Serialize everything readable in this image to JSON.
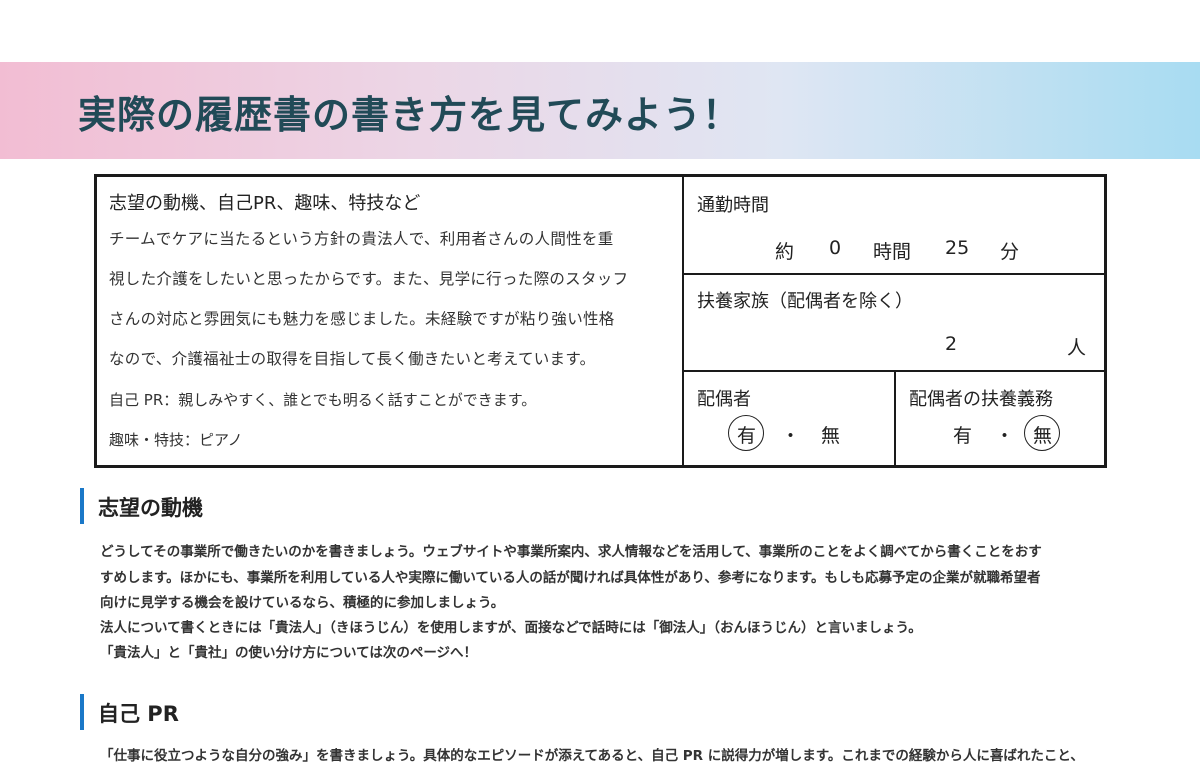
{
  "banner": {
    "title": "実際の履歴書の書き方を見てみよう！"
  },
  "form": {
    "motive_heading": "志望の動機、自己PR、趣味、特技など",
    "motive_lines": [
      "チームでケアに当たるという方針の貴法人で、利用者さんの人間性を重",
      "視した介護をしたいと思ったからです。また、見学に行った際のスタッフ",
      "さんの対応と雰囲気にも魅力を感じました。未経験ですが粘り強い性格",
      "なので、介護福祉士の取得を目指して長く働きたいと考えています。"
    ],
    "self_pr": "自己 PR：親しみやすく、誰とでも明るく話すことができます。",
    "hobby": "趣味・特技：ピアノ",
    "commute": {
      "label": "通勤時間",
      "prefix": "約",
      "hours": "0",
      "hours_unit": "時間",
      "minutes": "25",
      "minutes_unit": "分"
    },
    "dependents": {
      "label": "扶養家族（配偶者を除く）",
      "count": "2",
      "unit": "人"
    },
    "spouse": {
      "label": "配偶者",
      "yes": "有",
      "separator": "・",
      "no": "無",
      "selected": "有"
    },
    "spouse_support": {
      "label": "配偶者の扶養義務",
      "yes": "有",
      "separator": "・",
      "no": "無",
      "selected": "無"
    }
  },
  "sections": [
    {
      "title": "志望の動機",
      "lines": [
        "どうしてその事業所で働きたいのかを書きましょう。ウェブサイトや事業所案内、求人情報などを活用して、事業所のことをよく調べてから書くことをおす",
        "すめします。ほかにも、事業所を利用している人や実際に働いている人の話が聞ければ具体性があり、参考になります。もしも応募予定の企業が就職希望者",
        "向けに見学する機会を設けているなら、積極的に参加しましょう。",
        "法人について書くときには「貴法人」（きほうじん）を使用しますが、面接などで話時には「御法人」（おんほうじん）と言いましょう。",
        "「貴法人」と「貴社」の使い分け方については次のページへ！"
      ]
    },
    {
      "title": "自己 PR",
      "lines": [
        "「仕事に役立つような自分の強み」を書きましょう。具体的なエピソードが添えてあると、自己 PR に説得力が増します。これまでの経験から人に喜ばれたこと、"
      ]
    }
  ],
  "colors": {
    "title_text": "#214a57",
    "section_accent": "#1a78c8",
    "banner_left": "#f2bdd3",
    "banner_right": "#a8dcf2"
  }
}
